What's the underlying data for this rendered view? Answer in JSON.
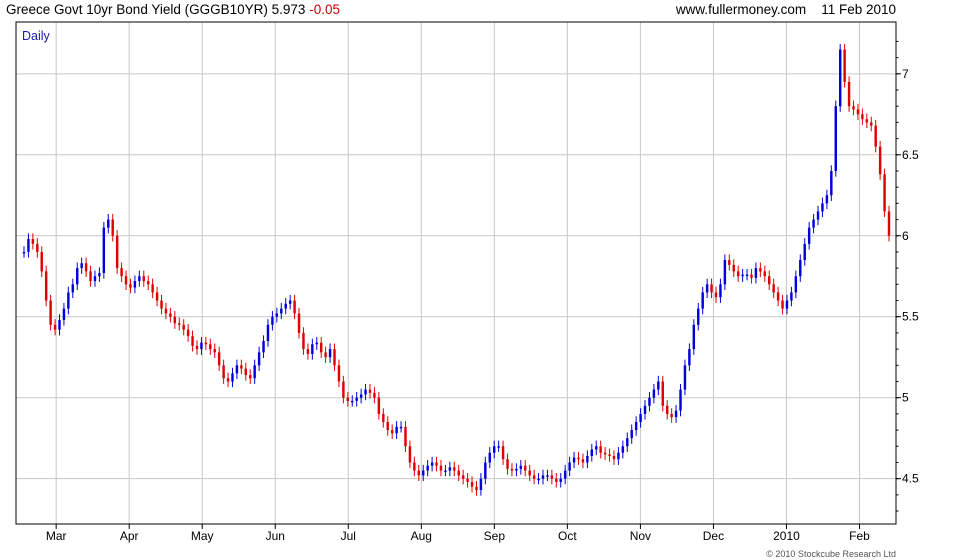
{
  "header": {
    "title": "Greece Govt 10yr Bond Yield (GGGB10YR)",
    "last": "5.973",
    "change": "-0.05",
    "site": "www.fullermoney.com",
    "date": "11 Feb 2010"
  },
  "footer": {
    "copyright": "© 2010 Stockcube Research Ltd"
  },
  "colors": {
    "up": "#0000dd",
    "down": "#e00000",
    "grid": "#c8c8c8",
    "frame": "#000000",
    "label": "#1a1aa8"
  },
  "chart_data": {
    "type": "candlestick",
    "period_label": "Daily",
    "x_ticks": [
      "Mar",
      "Apr",
      "May",
      "Jun",
      "Jul",
      "Aug",
      "Sep",
      "Oct",
      "Nov",
      "Dec",
      "2010",
      "Feb"
    ],
    "y_ticks": [
      "4.5",
      "5",
      "5.5",
      "6",
      "6.5",
      "7"
    ],
    "ylim": [
      4.22,
      7.32
    ],
    "grid": true,
    "series": [
      {
        "values": [
          5.9,
          5.98,
          5.95,
          5.9,
          5.78,
          5.6,
          5.45,
          5.42,
          5.48,
          5.55,
          5.65,
          5.7,
          5.8,
          5.83,
          5.78,
          5.72,
          5.75,
          5.77,
          6.05,
          6.1,
          6.0,
          5.8,
          5.75,
          5.7,
          5.68,
          5.72,
          5.75,
          5.72,
          5.7,
          5.65,
          5.6,
          5.55,
          5.52,
          5.5,
          5.46,
          5.45,
          5.42,
          5.38,
          5.32,
          5.3,
          5.34,
          5.33,
          5.3,
          5.28,
          5.2,
          5.12,
          5.1,
          5.15,
          5.2,
          5.18,
          5.14,
          5.12,
          5.2,
          5.28,
          5.35,
          5.45,
          5.5,
          5.52,
          5.55,
          5.58,
          5.6,
          5.52,
          5.4,
          5.3,
          5.27,
          5.33,
          5.34,
          5.28,
          5.25,
          5.3,
          5.2,
          5.1,
          5.0,
          4.98,
          4.98,
          5.0,
          5.02,
          5.05,
          5.03,
          5.0,
          4.9,
          4.85,
          4.8,
          4.78,
          4.82,
          4.82,
          4.7,
          4.6,
          4.55,
          4.52,
          4.55,
          4.58,
          4.6,
          4.58,
          4.55,
          4.55,
          4.57,
          4.55,
          4.52,
          4.5,
          4.48,
          4.45,
          4.43,
          4.5,
          4.6,
          4.66,
          4.7,
          4.7,
          4.62,
          4.56,
          4.55,
          4.56,
          4.58,
          4.55,
          4.52,
          4.5,
          4.5,
          4.52,
          4.52,
          4.5,
          4.48,
          4.5,
          4.55,
          4.6,
          4.63,
          4.62,
          4.6,
          4.64,
          4.68,
          4.7,
          4.66,
          4.65,
          4.64,
          4.62,
          4.66,
          4.7,
          4.75,
          4.8,
          4.85,
          4.9,
          4.95,
          5.0,
          5.05,
          5.1,
          4.95,
          4.9,
          4.88,
          4.92,
          5.05,
          5.2,
          5.3,
          5.45,
          5.55,
          5.65,
          5.7,
          5.65,
          5.62,
          5.7,
          5.85,
          5.82,
          5.78,
          5.75,
          5.76,
          5.76,
          5.74,
          5.8,
          5.78,
          5.75,
          5.7,
          5.65,
          5.6,
          5.55,
          5.6,
          5.65,
          5.75,
          5.85,
          5.95,
          6.05,
          6.1,
          6.15,
          6.2,
          6.25,
          6.4,
          6.8,
          7.15,
          6.95,
          6.8,
          6.78,
          6.75,
          6.72,
          6.7,
          6.68,
          6.55,
          6.38,
          6.15,
          6.0
        ]
      }
    ]
  }
}
